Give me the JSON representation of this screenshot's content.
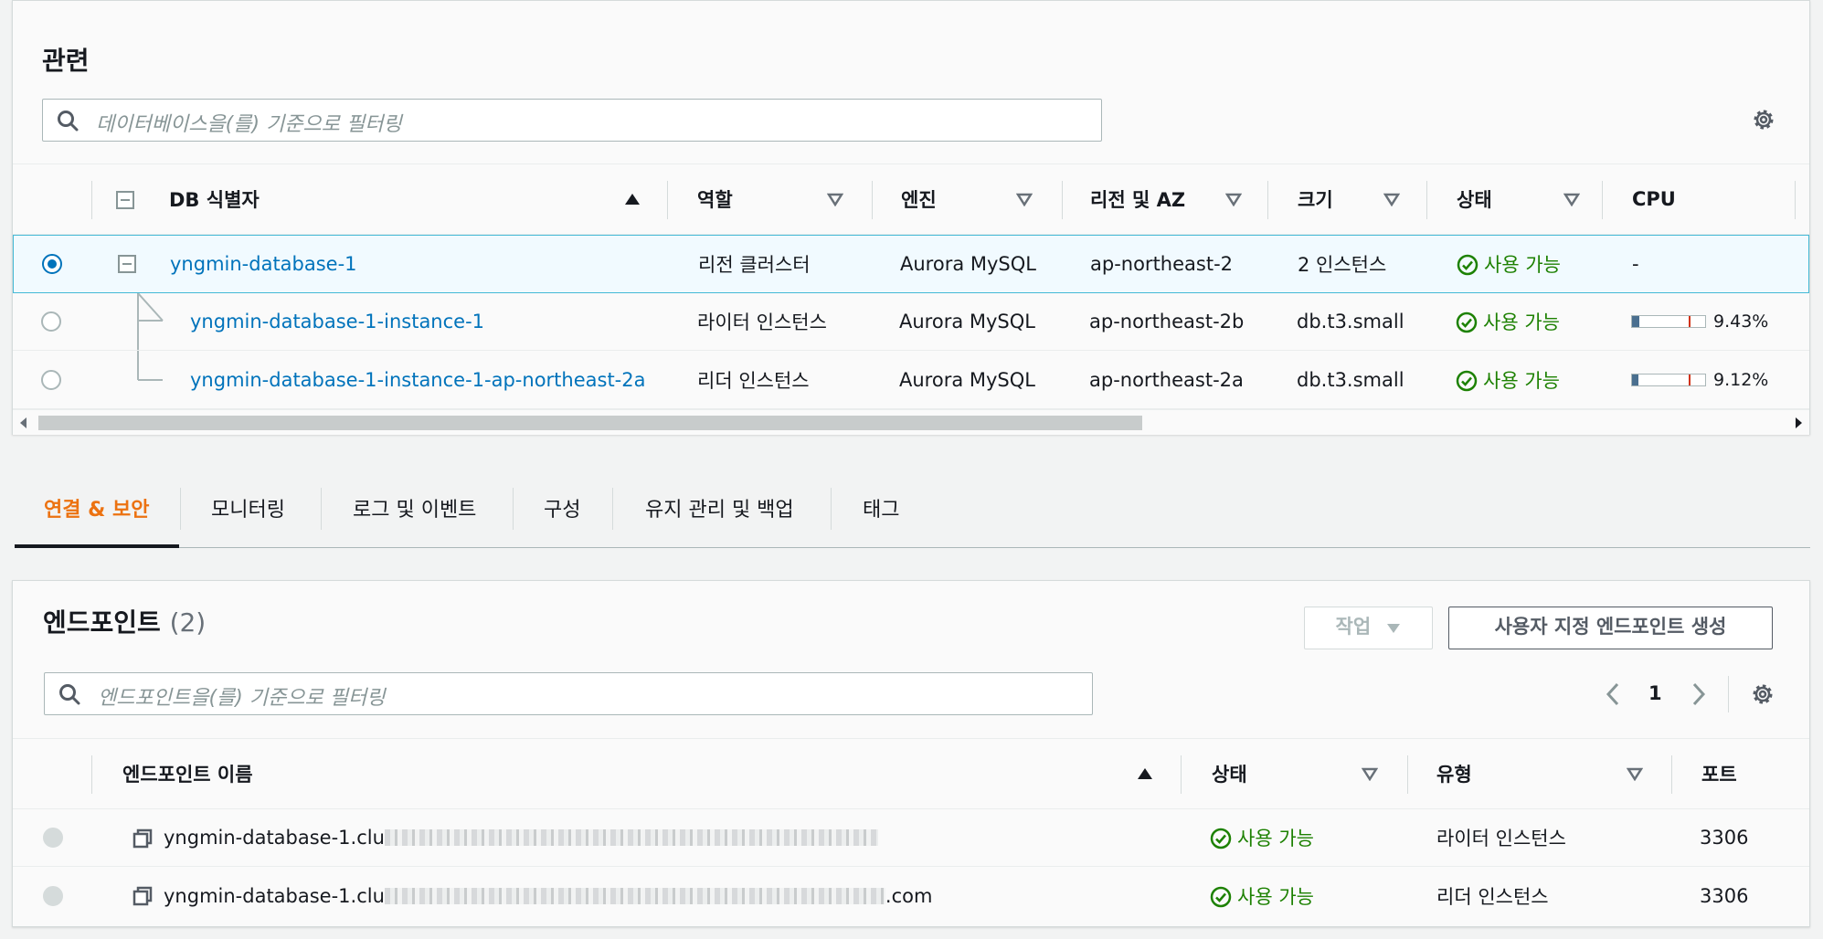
{
  "related": {
    "title": "관련",
    "filter_placeholder": "데이터베이스을(를) 기준으로 필터링",
    "columns": {
      "db_identifier": "DB 식별자",
      "role": "역할",
      "engine": "엔진",
      "region_az": "리전 및 AZ",
      "size": "크기",
      "status": "상태",
      "cpu": "CPU"
    },
    "rows": [
      {
        "identifier": "yngmin-database-1",
        "role": "리전 클러스터",
        "engine": "Aurora MySQL",
        "region_az": "ap-northeast-2",
        "size": "2 인스턴스",
        "status": "사용 가능",
        "cpu": "-",
        "selected": true
      },
      {
        "identifier": "yngmin-database-1-instance-1",
        "role": "라이터 인스턴스",
        "engine": "Aurora MySQL",
        "region_az": "ap-northeast-2b",
        "size": "db.t3.small",
        "status": "사용 가능",
        "cpu": "9.43%",
        "cpu_value": 9.43
      },
      {
        "identifier": "yngmin-database-1-instance-1-ap-northeast-2a",
        "role": "리더 인스턴스",
        "engine": "Aurora MySQL",
        "region_az": "ap-northeast-2a",
        "size": "db.t3.small",
        "status": "사용 가능",
        "cpu": "9.12%",
        "cpu_value": 9.12
      }
    ]
  },
  "tabs": [
    {
      "label": "연결 & 보안",
      "active": true
    },
    {
      "label": "모니터링"
    },
    {
      "label": "로그 및 이벤트"
    },
    {
      "label": "구성"
    },
    {
      "label": "유지 관리 및 백업"
    },
    {
      "label": "태그"
    }
  ],
  "endpoints": {
    "title": "엔드포인트",
    "count": "(2)",
    "actions_label": "작업",
    "create_label": "사용자 지정 엔드포인트 생성",
    "filter_placeholder": "엔드포인트을(를) 기준으로 필터링",
    "page": "1",
    "columns": {
      "name": "엔드포인트 이름",
      "status": "상태",
      "type": "유형",
      "port": "포트"
    },
    "rows": [
      {
        "name_visible": "yngmin-database-1.clu",
        "name_suffix": "",
        "status": "사용 가능",
        "type": "라이터 인스턴스",
        "port": "3306"
      },
      {
        "name_visible": "yngmin-database-1.clu",
        "name_suffix": ".com",
        "status": "사용 가능",
        "type": "리더 인스턴스",
        "port": "3306"
      }
    ]
  },
  "colors": {
    "link": "#0073bb",
    "success": "#1d8102",
    "active_tab": "#ec7211",
    "cpu_fill": "#4a6f8f",
    "cpu_threshold": "#d13212"
  }
}
